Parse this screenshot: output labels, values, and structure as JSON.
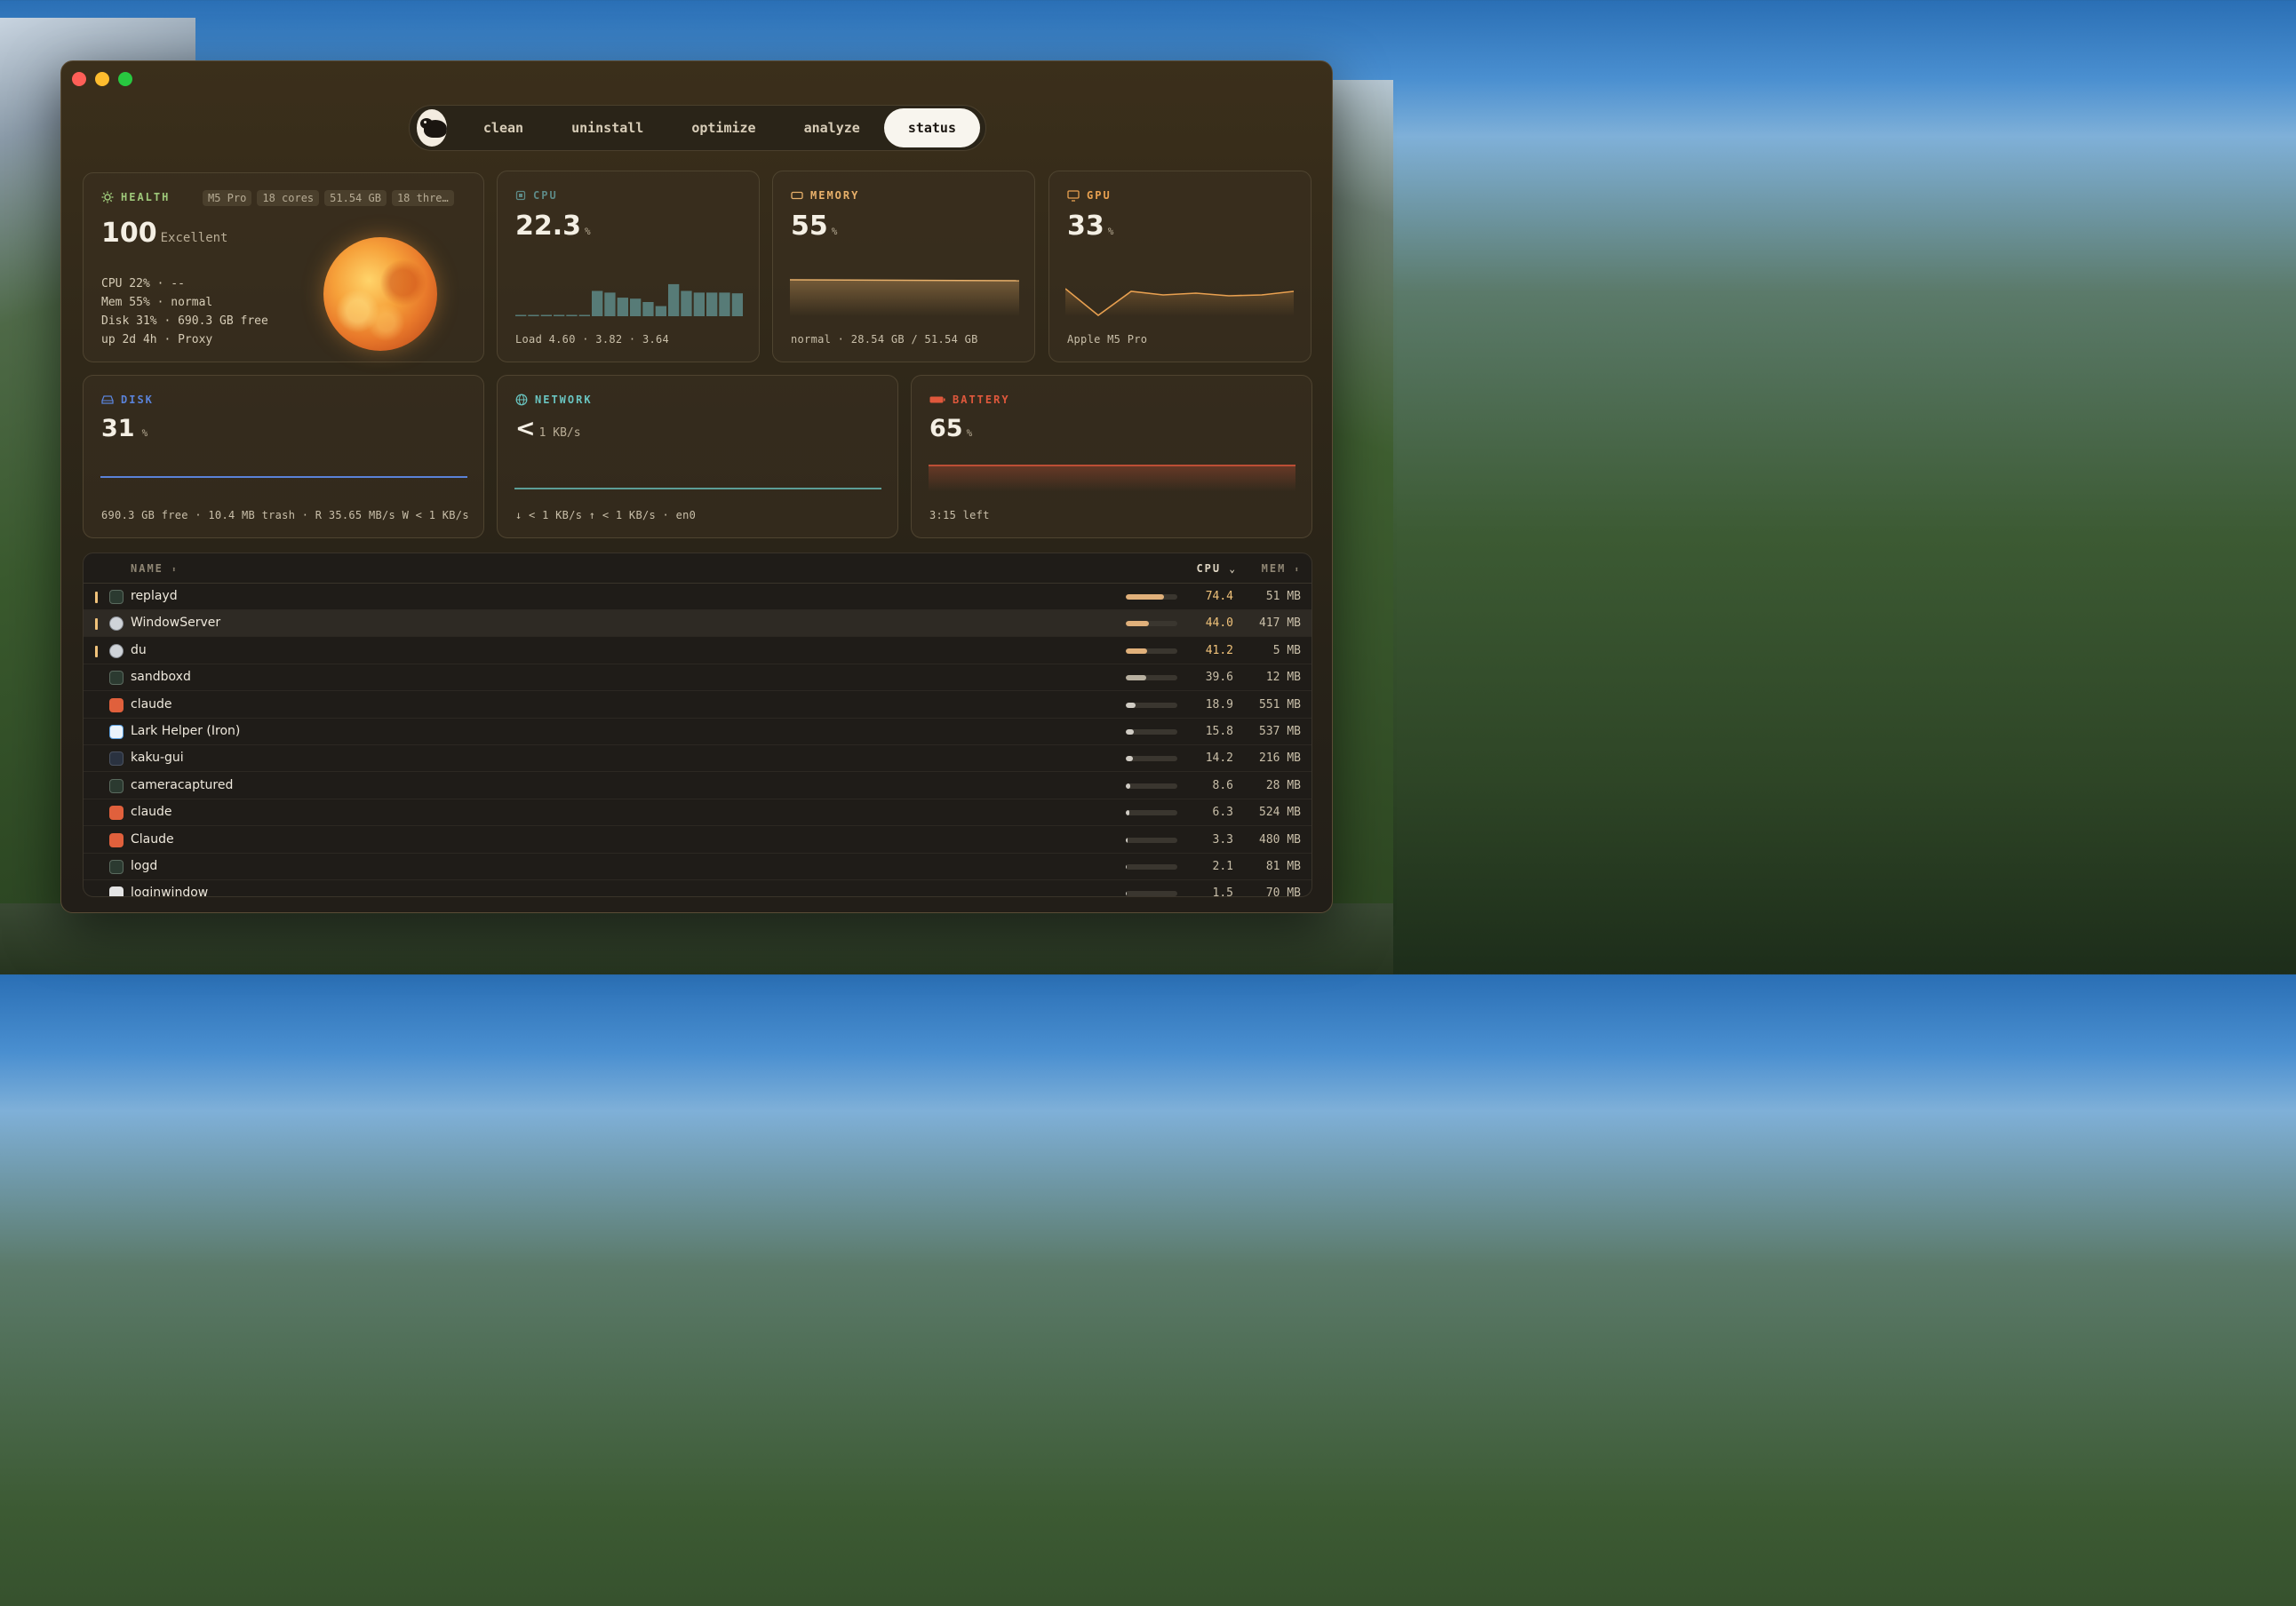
{
  "nav": {
    "tabs": [
      {
        "label": "clean"
      },
      {
        "label": "uninstall"
      },
      {
        "label": "optimize"
      },
      {
        "label": "analyze"
      },
      {
        "label": "status"
      }
    ],
    "active": "status"
  },
  "health": {
    "title": "HEALTH",
    "chips": [
      "M5 Pro",
      "18 cores",
      "51.54 GB",
      "18 thre…"
    ],
    "score": "100",
    "rating": "Excellent",
    "lines": [
      "CPU 22% · --",
      "Mem 55% · normal",
      "Disk 31% · 690.3 GB free",
      "up 2d 4h · Proxy"
    ]
  },
  "cpu": {
    "title": "CPU",
    "value": "22.3",
    "unit": "%",
    "footer": "Load 4.60 · 3.82 · 3.64",
    "history": [
      0.02,
      0.02,
      0.02,
      0.02,
      0.02,
      0.02,
      0.75,
      0.7,
      0.55,
      0.52,
      0.42,
      0.3,
      0.95,
      0.75,
      0.7,
      0.7,
      0.7,
      0.68
    ]
  },
  "memory": {
    "title": "MEMORY",
    "value": "55",
    "unit": "%",
    "footer": "normal · 28.54 GB / 51.54 GB"
  },
  "gpu": {
    "title": "GPU",
    "value": "33",
    "unit": "%",
    "footer": "Apple M5 Pro"
  },
  "disk": {
    "title": "DISK",
    "value": "31",
    "unit": "%",
    "footer": "690.3 GB free · 10.4 MB trash · R 35.65 MB/s W < 1 KB/s"
  },
  "network": {
    "title": "NETWORK",
    "value": "<",
    "unit": "1 KB/s",
    "footer": "↓ < 1 KB/s  ↑ < 1 KB/s · en0"
  },
  "battery": {
    "title": "BATTERY",
    "value": "65",
    "unit": "%",
    "footer": "3:15 left"
  },
  "table": {
    "col_name": "NAME",
    "col_cpu": "CPU",
    "col_mem": "MEM",
    "rows": [
      {
        "name": "replayd",
        "cpu": "74.4",
        "mem": "51 MB",
        "cpu_pct": 74.4,
        "icon": "terminal-icon"
      },
      {
        "name": "WindowServer",
        "cpu": "44.0",
        "mem": "417 MB",
        "cpu_pct": 44.0,
        "icon": "system-icon"
      },
      {
        "name": "du",
        "cpu": "41.2",
        "mem": "5 MB",
        "cpu_pct": 41.2,
        "icon": "system-icon"
      },
      {
        "name": "sandboxd",
        "cpu": "39.6",
        "mem": "12 MB",
        "cpu_pct": 39.6,
        "icon": "terminal-icon"
      },
      {
        "name": "claude",
        "cpu": "18.9",
        "mem": "551 MB",
        "cpu_pct": 18.9,
        "icon": "claude-icon"
      },
      {
        "name": "Lark Helper (Iron)",
        "cpu": "15.8",
        "mem": "537 MB",
        "cpu_pct": 15.8,
        "icon": "lark-icon"
      },
      {
        "name": "kaku-gui",
        "cpu": "14.2",
        "mem": "216 MB",
        "cpu_pct": 14.2,
        "icon": "shell-icon"
      },
      {
        "name": "cameracaptured",
        "cpu": "8.6",
        "mem": "28 MB",
        "cpu_pct": 8.6,
        "icon": "terminal-icon"
      },
      {
        "name": "claude",
        "cpu": "6.3",
        "mem": "524 MB",
        "cpu_pct": 6.3,
        "icon": "claude-icon"
      },
      {
        "name": "Claude",
        "cpu": "3.3",
        "mem": "480 MB",
        "cpu_pct": 3.3,
        "icon": "claude-icon"
      },
      {
        "name": "logd",
        "cpu": "2.1",
        "mem": "81 MB",
        "cpu_pct": 2.1,
        "icon": "terminal-icon"
      },
      {
        "name": "loginwindow",
        "cpu": "1.5",
        "mem": "70 MB",
        "cpu_pct": 1.5,
        "icon": "window-icon"
      }
    ]
  },
  "colors": {
    "health": "#9ec87a",
    "cpu": "#5d8a87",
    "memory": "#e8b06a",
    "gpu": "#e8a050",
    "disk": "#5a82d8",
    "network": "#6ac4c0",
    "battery": "#e0583c",
    "cpu_hot": "#f0c27a"
  }
}
